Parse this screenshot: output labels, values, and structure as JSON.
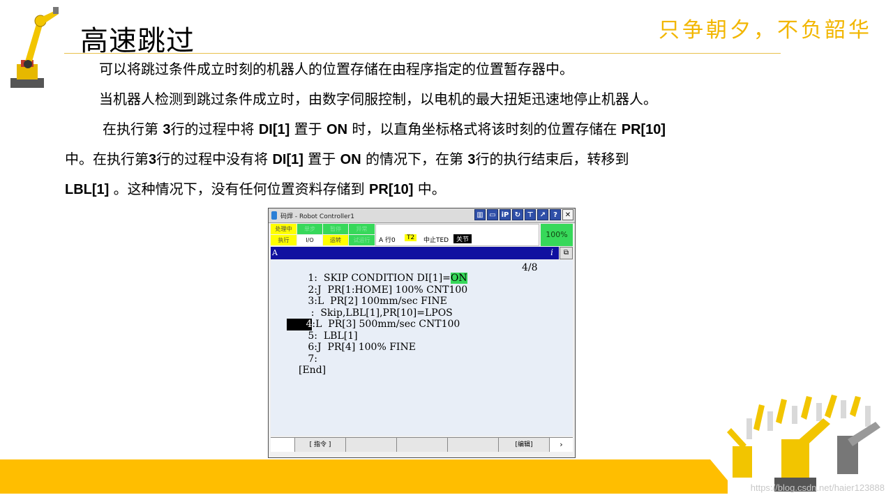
{
  "slide": {
    "title": "高速跳过",
    "slogan": "只争朝夕，不负韶华",
    "paragraphs": {
      "p1": "可以将跳过条件成立时刻的机器人的位置存储在由程序指定的位置暂存器中。",
      "p2": "当机器人检测到跳过条件成立时，由数字伺服控制，以电机的最大扭矩迅速地停止机器人。",
      "p3": [
        "在执行第 ",
        "3",
        "行的过程中将 ",
        "DI[1]",
        " 置于 ",
        "ON",
        " 时，以直角坐标格式将该时刻的位置存储在 ",
        "PR[10]"
      ],
      "p4": [
        "中。在执行第",
        "3",
        "行的过程中没有将 ",
        "DI[1]",
        " 置于 ",
        "ON",
        " 的情况下，在第 ",
        "3",
        "行的执行结束后，转移到"
      ],
      "p5": [
        "LBL[1]",
        " 。这种情况下，没有任何位置资料存储到 ",
        "PR[10]",
        " 中。"
      ]
    },
    "watermark": "https://blog.csdn.net/haier123888"
  },
  "pendant": {
    "window_title": "码焊 - Robot Controller1",
    "titlebar_buttons": [
      "▥",
      "▭",
      "iP",
      "↻",
      "⊤",
      "↗",
      "?",
      "✕"
    ],
    "status": {
      "row1": [
        "处理中",
        "单步",
        "暂停",
        "异常"
      ],
      "row2": [
        "执行",
        "I/O",
        "运转",
        "试运行"
      ],
      "line": "A  行0",
      "mode": "T2",
      "stop": "中止TED",
      "coord": "关节",
      "override": "100%"
    },
    "program_bar": {
      "name": "A",
      "info_icon": "i"
    },
    "position": "4/8",
    "lines": {
      "l1_num": "1:",
      "l1_text": "  SKIP CONDITION DI[1]=",
      "l1_on": "ON",
      "l2": "2:J  PR[1:HOME] 100% CNT100",
      "l3": "3:L  PR[2] 100mm/sec FINE",
      "l3b": " :  Skip,LBL[1],PR[10]=LPOS",
      "l4_num": "4",
      "l4_text": ":L  PR[3] 500mm/sec CNT100",
      "l5": "5:  LBL[1]",
      "l6": "6:J  PR[4] 100% FINE",
      "l7": "7:",
      "end": "[End]"
    },
    "fkeys": [
      "",
      "[ 指令 ]",
      "",
      "",
      "",
      "[编辑]",
      "›"
    ]
  },
  "colors": {
    "accent_yellow": "#ffbe00",
    "slogan": "#f2b600",
    "program_bar": "#1010a0",
    "status_green": "#37d85a"
  }
}
